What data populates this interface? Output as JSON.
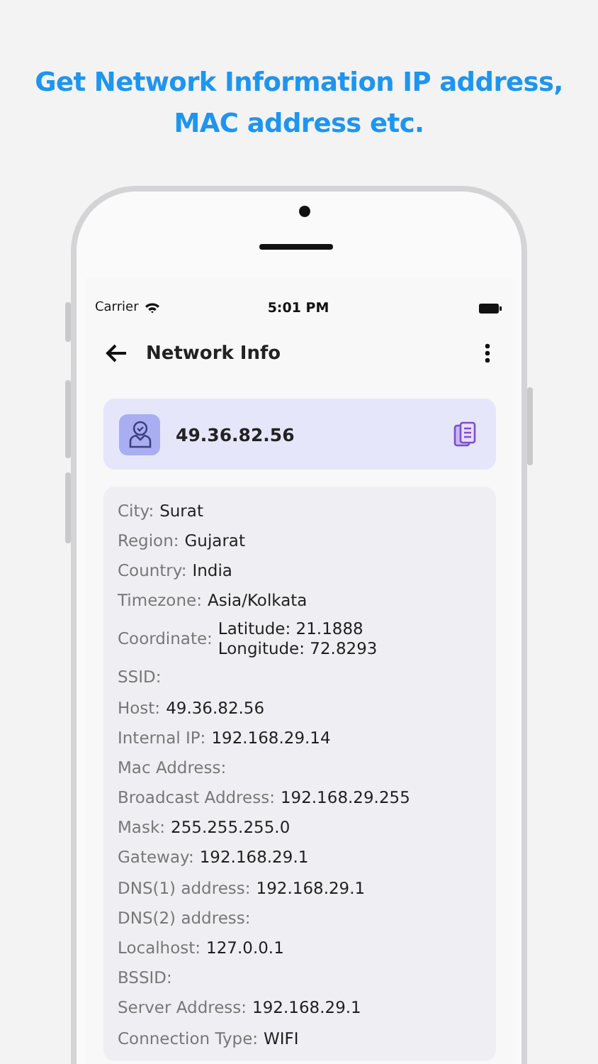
{
  "headline": [
    "Get Network Information IP address,",
    "MAC address etc."
  ],
  "status_bar": {
    "carrier": "Carrier",
    "time": "5:01 PM"
  },
  "app_bar": {
    "title": "Network Info"
  },
  "ip_card": {
    "ip": "49.36.82.56"
  },
  "info_rows": [
    {
      "kind": "single",
      "label": "City:",
      "value": "Surat"
    },
    {
      "kind": "single",
      "label": "Region:",
      "value": "Gujarat"
    },
    {
      "kind": "single",
      "label": "Country:",
      "value": "India"
    },
    {
      "kind": "single",
      "label": "Timezone:",
      "value": "Asia/Kolkata"
    },
    {
      "kind": "multi",
      "label": "Coordinate:",
      "lines": [
        "Latitude: 21.1888",
        "Longitude: 72.8293"
      ]
    },
    {
      "kind": "single",
      "label": "SSID:"
    },
    {
      "kind": "single",
      "label": "Host:",
      "value": "49.36.82.56"
    },
    {
      "kind": "single",
      "label": "Internal IP:",
      "value": "192.168.29.14"
    },
    {
      "kind": "single",
      "label": "Mac Address:"
    },
    {
      "kind": "single",
      "label": "Broadcast Address:",
      "value": "192.168.29.255"
    },
    {
      "kind": "single",
      "label": "Mask:",
      "value": "255.255.255.0"
    },
    {
      "kind": "single",
      "label": "Gateway:",
      "value": "192.168.29.1"
    },
    {
      "kind": "single",
      "label": "DNS(1) address:",
      "value": "192.168.29.1"
    },
    {
      "kind": "single",
      "label": "DNS(2) address:"
    },
    {
      "kind": "single",
      "label": "Localhost:",
      "value": "127.0.0.1"
    },
    {
      "kind": "single",
      "label": "BSSID:"
    },
    {
      "kind": "single",
      "label": "Server Address:",
      "value": "192.168.29.1"
    },
    {
      "kind": "single",
      "label": "Connection Type:",
      "value": "WIFI"
    }
  ]
}
